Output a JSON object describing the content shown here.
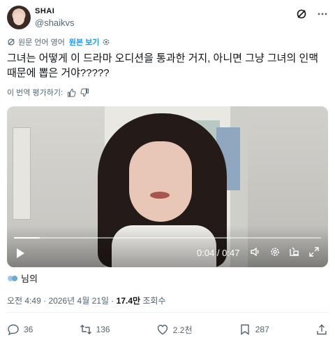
{
  "author": {
    "display_name": "SHAI",
    "handle": "@shaikvs"
  },
  "translation": {
    "label": "원문 언어 영어",
    "link": "원본 보기"
  },
  "tweet": {
    "text": "그녀는 어떻게 이 드라마 오디션을 통과한 거지, 아니면 그냥 그녀의 인맥 때문에 뽑은 거야?????"
  },
  "rating": {
    "label": "이 번역 평가하기:"
  },
  "video": {
    "current_time": "0:04",
    "duration": "0:47",
    "time_text": "0:04 / 0:47",
    "progress": 0.085
  },
  "likers": {
    "label": "님의"
  },
  "meta": {
    "time": "오전 4:49",
    "date": "2026년 4월 21일",
    "views": "17.4만",
    "views_label": "조회수",
    "sep": " · "
  },
  "actions": {
    "replies": "36",
    "reposts": "136",
    "likes": "2.2천",
    " bookmarks": "287"
  },
  "colors": {
    "accent": "#1d9bf0",
    "secondary_text": "#536471",
    "text": "#0f1419"
  },
  "icons": [
    "grok-icon",
    "more-icon",
    "translate-icon",
    "gear-icon",
    "thumbs-up-icon",
    "thumbs-down-icon",
    "play-icon",
    "volume-icon",
    "settings-icon",
    "pip-icon",
    "fullscreen-icon",
    "reply-icon",
    "repost-icon",
    "like-icon",
    "bookmark-icon",
    "share-icon"
  ]
}
